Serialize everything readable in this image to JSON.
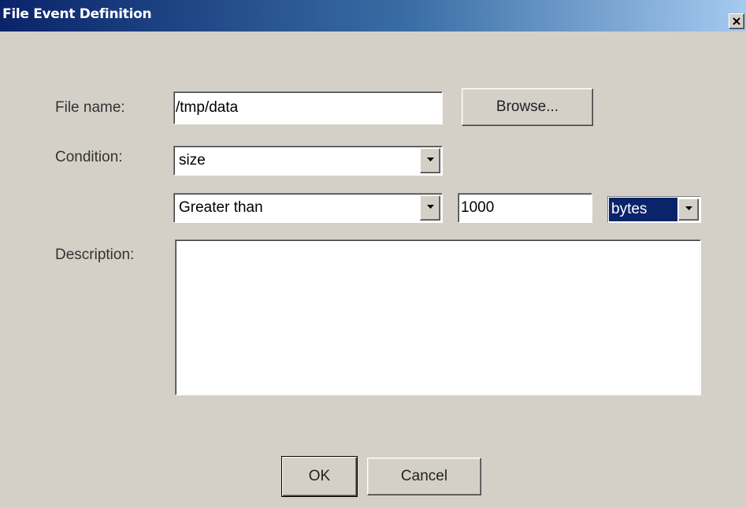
{
  "window": {
    "title": "File Event Definition",
    "close_icon": "close-icon"
  },
  "form": {
    "file_name_label": "File name:",
    "file_name_value": "/tmp/data",
    "browse_label": "Browse...",
    "condition_label": "Condition:",
    "condition_value": "size",
    "comparison_value": "Greater than",
    "threshold_value": "1000",
    "units_value": "bytes",
    "description_label": "Description:",
    "description_value": ""
  },
  "buttons": {
    "ok_label": "OK",
    "cancel_label": "Cancel"
  },
  "colors": {
    "titlebar_start": "#0a246a",
    "titlebar_end": "#a6caf0",
    "dialog_bg": "#d4d0c8",
    "selection": "#0a246a"
  }
}
